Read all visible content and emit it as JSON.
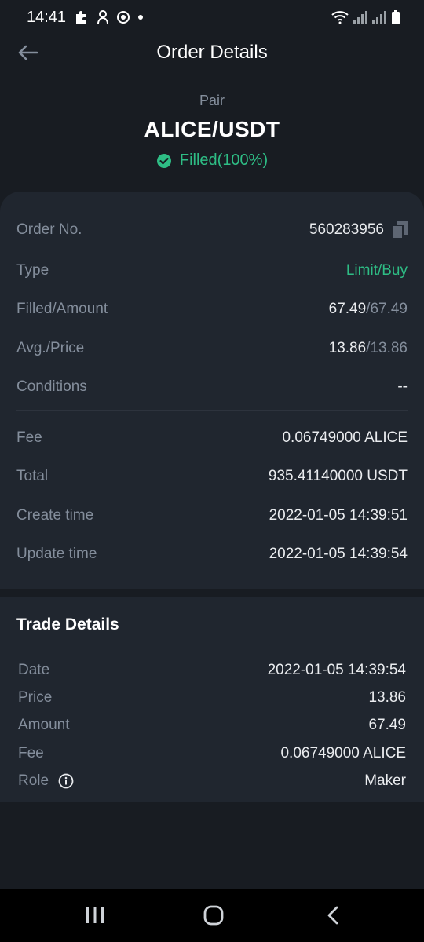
{
  "status_bar": {
    "time": "14:41"
  },
  "header": {
    "title": "Order Details"
  },
  "pair": {
    "label": "Pair",
    "name": "ALICE/USDT",
    "status": "Filled(100%)"
  },
  "order": {
    "order_no": {
      "label": "Order No.",
      "value": "560283956"
    },
    "type": {
      "label": "Type",
      "value": "Limit/Buy"
    },
    "filled_amount": {
      "label": "Filled/Amount",
      "filled": "67.49",
      "amount": "/67.49"
    },
    "avg_price": {
      "label": "Avg./Price",
      "avg": "13.86",
      "price": "/13.86"
    },
    "conditions": {
      "label": "Conditions",
      "value": "--"
    },
    "fee": {
      "label": "Fee",
      "value": "0.06749000 ALICE"
    },
    "total": {
      "label": "Total",
      "value": "935.41140000 USDT"
    },
    "create_time": {
      "label": "Create time",
      "value": "2022-01-05 14:39:51"
    },
    "update_time": {
      "label": "Update time",
      "value": "2022-01-05 14:39:54"
    }
  },
  "trade_details": {
    "title": "Trade Details",
    "date": {
      "label": "Date",
      "value": "2022-01-05 14:39:54"
    },
    "price": {
      "label": "Price",
      "value": "13.86"
    },
    "amount": {
      "label": "Amount",
      "value": "67.49"
    },
    "fee": {
      "label": "Fee",
      "value": "0.06749000 ALICE"
    },
    "role": {
      "label": "Role",
      "value": "Maker"
    }
  },
  "colors": {
    "background": "#181c22",
    "card": "#20262f",
    "accent_green": "#2ebd85",
    "muted_text": "#848e9c"
  }
}
